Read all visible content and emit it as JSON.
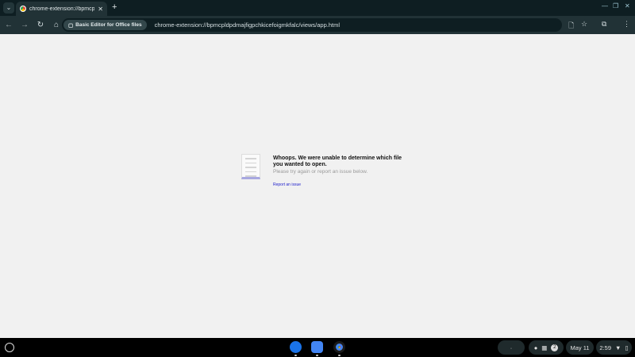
{
  "browser": {
    "tab_title": "chrome-extension://bpmcpldpdmajfigpchkicefoigmkfalc/views/app.html",
    "tab_display": "chrome-extension://bpmcpldpd",
    "chip_label": "Basic Editor for Office files",
    "url": "chrome-extension://bpmcpldpdmajfigpchkicefoigmkfalc/views/app.html"
  },
  "page": {
    "title": "Whoops. We were unable to determine which file you wanted to open.",
    "subtitle": "Please try again or report an issue below.",
    "report_link": "Report an issue"
  },
  "shelf": {
    "notification_count": "2",
    "date": "May 11",
    "time": "2:59"
  }
}
